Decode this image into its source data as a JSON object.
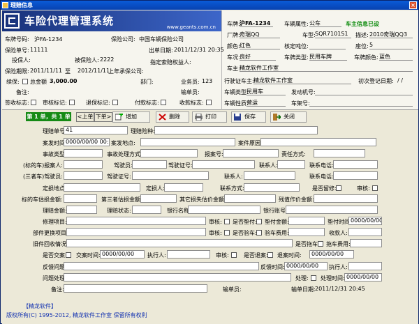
{
  "window": {
    "title": "理赔信息",
    "close": "×"
  },
  "banner": {
    "title": "车险代理管理系统",
    "site": "www.geants.com.cn"
  },
  "left": {
    "plate_lbl": "车牌号码:",
    "plate": "沪FA-1234",
    "insurer_lbl": "保险公司:",
    "insurer": "中国车辆保险公司",
    "policy_lbl": "保险单号:",
    "policy": "11111",
    "issue_lbl": "出单日期:",
    "issue": "2011/12/31 20:35",
    "holder_lbl": "投保人:",
    "insured_lbl": "被保险人:",
    "insured": "2222",
    "beneficiary_lbl": "指定索赔权益人:",
    "period_lbl": "保险期限:",
    "period_from": "2011/11/11",
    "to_lbl": "至",
    "period_to": "2012/11/11",
    "prev_lbl": "上年承保公司:",
    "renew_lbl": "续保:",
    "total_lbl": "总金额",
    "total": "3,000.00",
    "dept_lbl": "部门:",
    "staff_lbl": "业务员:",
    "staff": "123",
    "remark_lbl": "备注:",
    "handler_lbl": "输单员:",
    "sign_lbl": "签收标志:",
    "audit_lbl": "审核标记:",
    "refund_lbl": "退保标记:",
    "pay_lbl": "付款标志:",
    "recv_lbl": "收款标志:"
  },
  "right": {
    "plate_lbl": "车牌:",
    "plate": "沪FA-1234",
    "nature_lbl": "车辆属性:",
    "nature": "公车",
    "status": "车主信息已设",
    "brand_lbl": "厂牌:",
    "brand": "奇瑞QQ",
    "model_lbl": "车型:",
    "model": "SQR7101S1",
    "desc_lbl": "描述:",
    "desc": "2010奇瑞QQ3",
    "color_lbl": "颜色:",
    "color": "红色",
    "load_lbl": "核定吨位:",
    "seats_lbl": "座位:",
    "seats": "5",
    "cond_lbl": "车况:",
    "cond": "良好",
    "platetype_lbl": "车牌类型:",
    "platetype": "民用车牌",
    "platecolor_lbl": "车牌颜色:",
    "platecolor": "蓝色",
    "owner_lbl": "车主:",
    "owner": "精龙软件工作室",
    "lic_lbl": "行驶证车主:",
    "lic": "精龙软件工作室",
    "reg_lbl": "初次登记日期:",
    "reg": "/ /",
    "type_lbl": "车辆类型:",
    "type": "民用车",
    "engine_lbl": "发动机号:",
    "use_lbl": "车辆性质:",
    "use": "营运",
    "frame_lbl": "车架号:"
  },
  "toolbar": {
    "pager": "第 1 单，共 1 单",
    "prev": "<上单",
    "next": "下单>",
    "add": "增加",
    "del": "删除",
    "print": "打印",
    "save": "保存",
    "close": "关闭"
  },
  "form": {
    "claim_no_lbl": "理赔单号:",
    "claim_no": "41",
    "claim_type_lbl": "理赔险种:",
    "time_lbl": "案发时间:",
    "time": "0000/00/00 00:00",
    "place_lbl": "案发地点:",
    "reason_lbl": "案件原因:",
    "acc_type_lbl": "事故类型:",
    "acc_way_lbl": "事故处理方式:",
    "report_lbl": "报案号:",
    "resp_lbl": "责任方式:",
    "own_reporter_lbl": "(标的车)报案人:",
    "driver_lbl": "驾驶员:",
    "license_lbl": "驾驶证号:",
    "contact_lbl": "联系人:",
    "phone_lbl": "联系电话:",
    "tp_driver_lbl": "(三者车)驾驶员:",
    "tp_license_lbl": "驾驶证号:",
    "tp_contact_lbl": "联系人:",
    "tp_phone_lbl": "联系电话:",
    "loss_place_lbl": "定损地点:",
    "loss_person_lbl": "定损人:",
    "contact_way_lbl": "联系方式:",
    "tracked_lbl": "是否留修:",
    "audit_lbl": "审核:",
    "own_loss_lbl": "标的车估损金额:",
    "tp_loss_lbl": "第三者估损金额:",
    "other_loss_lbl": "其它损失估价金额:",
    "residual_lbl": "残值作价金额:",
    "claim_amt_lbl": "理赔金额:",
    "claim_status_lbl": "理赔状态:",
    "bank_lbl": "银行名称:",
    "account_lbl": "银行账号:",
    "repair_lbl": "修理项目:",
    "audit2_lbl": "审核:",
    "advance_lbl": "是否垫付:",
    "advance_amt_lbl": "垫付金额:",
    "advance_time_lbl": "垫付时间:",
    "advance_time": "0000/00/00",
    "parts_lbl": "部件更换项目:",
    "audit3_lbl": "审核:",
    "inspect_lbl": "是否验车:",
    "inspect_fee_lbl": "验车费用:",
    "receiver_lbl": "收款人:",
    "oldparts_lbl": "旧件回收情况:",
    "drag_lbl": "是否拖车:",
    "drag_fee_lbl": "拖车费用:",
    "handover_lbl": "是否交案:",
    "handover_time_lbl": "交案时间:",
    "handover_time": "0000/00/00",
    "exec_lbl": "执行人:",
    "audit4_lbl": "审核:",
    "settle_lbl": "是否退案:",
    "settle_time_lbl": "退案时间:",
    "settle_time": "0000/00/00",
    "feedback_lbl": "反馈问题:",
    "fb_time_lbl": "反馈时间:",
    "fb_time": "0000/00/00",
    "fb_exec_lbl": "执行人:",
    "issue_lbl": "问题处理:",
    "handled_lbl": "处理:",
    "handle_time_lbl": "处理时间:",
    "handle_time": "0000/00/00",
    "remark_lbl": "备注:",
    "inputer_lbl": "输单员:",
    "input_date_lbl": "输单日期:",
    "input_date": "2011/12/31 20:45"
  },
  "footer": {
    "link": "【精龙软件】",
    "copy": "版权所有(C) 1995-2012, 精龙软件工作室 保留所有权利"
  },
  "colors": {
    "title": "#0a5bd8",
    "banner": "#18327a",
    "pager": "#158a15"
  }
}
